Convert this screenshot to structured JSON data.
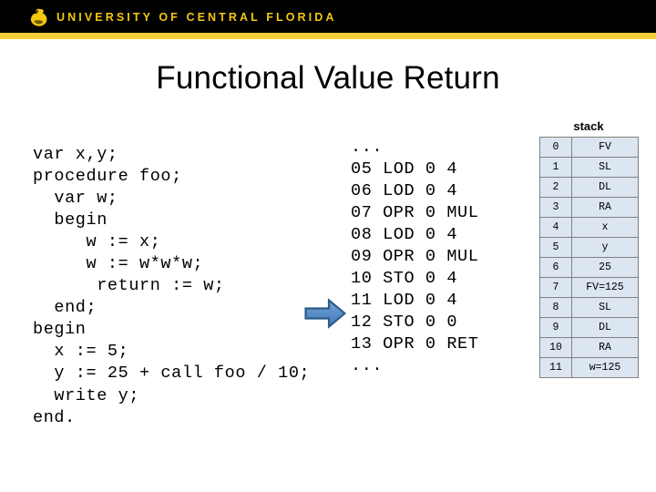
{
  "header": {
    "wordmark": "UNIVERSITY OF CENTRAL FLORIDA",
    "logo_icon": "ucf-pegasus-icon",
    "band_color": "#000000",
    "stripe_color": "#f5d03c",
    "wordmark_color": "#f2c811"
  },
  "slide": {
    "title": "Functional Value Return"
  },
  "source_code": {
    "language": "pl0",
    "text": "var x,y;\nprocedure foo;\n  var w;\n  begin\n     w := x;\n     w := w*w*w;\n      return := w;\n  end;\nbegin\n  x := 5;\n  y := 25 + call foo / 10;\n  write y;\nend."
  },
  "assembly": {
    "top_ellipsis": "...",
    "bottom_ellipsis": "...",
    "instructions": [
      {
        "address": "05",
        "op": "LOD",
        "level": "0",
        "operand": "4"
      },
      {
        "address": "06",
        "op": "LOD",
        "level": "0",
        "operand": "4"
      },
      {
        "address": "07",
        "op": "OPR",
        "level": "0",
        "operand": "MUL"
      },
      {
        "address": "08",
        "op": "LOD",
        "level": "0",
        "operand": "4"
      },
      {
        "address": "09",
        "op": "OPR",
        "level": "0",
        "operand": "MUL"
      },
      {
        "address": "10",
        "op": "STO",
        "level": "0",
        "operand": "4"
      },
      {
        "address": "11",
        "op": "LOD",
        "level": "0",
        "operand": "4"
      },
      {
        "address": "12",
        "op": "STO",
        "level": "0",
        "operand": "0"
      },
      {
        "address": "13",
        "op": "OPR",
        "level": "0",
        "operand": "RET"
      }
    ],
    "text": "...\n05 LOD 0 4\n06 LOD 0 4\n07 OPR 0 MUL\n08 LOD 0 4\n09 OPR 0 MUL\n10 STO 0 4\n11 LOD 0 4\n12 STO 0 0\n13 OPR 0 RET\n..."
  },
  "pointer": {
    "icon": "right-arrow-icon",
    "points_to_address": "12",
    "fill_color": "#5b8fc9",
    "border_color": "#2e5b8c"
  },
  "stack": {
    "caption": "stack",
    "cell_background": "#dce6f1",
    "border_color": "#808080",
    "rows": [
      {
        "index": "0",
        "value": "FV"
      },
      {
        "index": "1",
        "value": "SL"
      },
      {
        "index": "2",
        "value": "DL"
      },
      {
        "index": "3",
        "value": "RA"
      },
      {
        "index": "4",
        "value": "x"
      },
      {
        "index": "5",
        "value": "y"
      },
      {
        "index": "6",
        "value": "25"
      },
      {
        "index": "7",
        "value": "FV=125"
      },
      {
        "index": "8",
        "value": "SL"
      },
      {
        "index": "9",
        "value": "DL"
      },
      {
        "index": "10",
        "value": "RA"
      },
      {
        "index": "11",
        "value": "w=125"
      }
    ]
  }
}
